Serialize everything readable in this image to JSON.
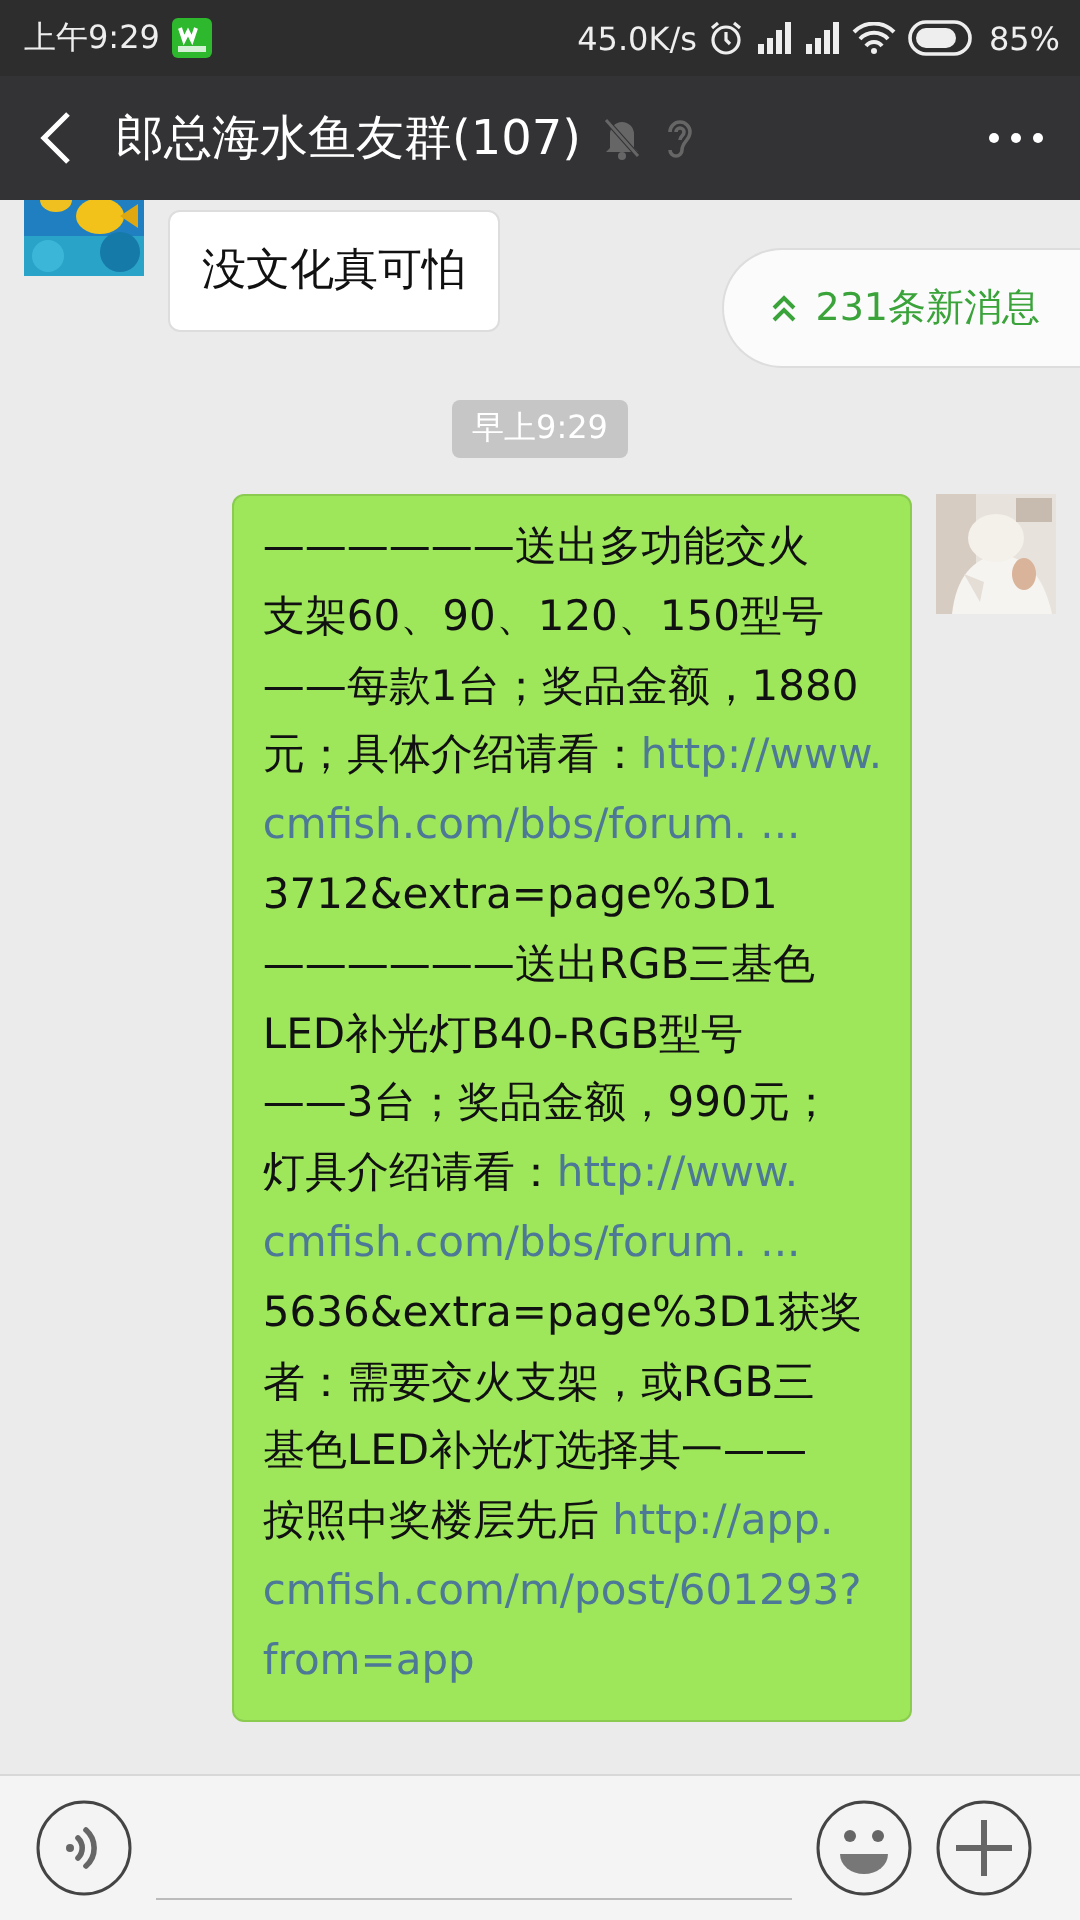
{
  "status_bar": {
    "time": "上午9:29",
    "speed": "45.0K/s",
    "battery": "85%"
  },
  "header": {
    "title": "郎总海水鱼友群(107)"
  },
  "new_messages": {
    "text": "231条新消息"
  },
  "messages": [
    {
      "kind": "bubble",
      "outgoing": false,
      "lines": [
        [
          {
            "kind": "text",
            "text": "没文化真可怕"
          }
        ]
      ]
    },
    {
      "kind": "time",
      "text": "早上9:29"
    },
    {
      "kind": "bubble",
      "outgoing": true,
      "lines": [
        [
          {
            "kind": "text",
            "text": "——————送出多功能交火"
          }
        ],
        [
          {
            "kind": "text",
            "text": "支架60、90、120、150型号"
          }
        ],
        [
          {
            "kind": "text",
            "text": "——每款1台；奖品金额，1880"
          }
        ],
        [
          {
            "kind": "text",
            "text": "元；具体介绍请看："
          },
          {
            "kind": "link",
            "text": "http://www."
          }
        ],
        [
          {
            "kind": "link",
            "text": "cmfish.com/bbs/forum. ..."
          }
        ],
        [
          {
            "kind": "text",
            "text": "3712&extra=page%3D1"
          }
        ],
        [
          {
            "kind": "text",
            "text": "——————送出RGB三基色"
          }
        ],
        [
          {
            "kind": "text",
            "text": "LED补光灯B40-RGB型号"
          }
        ],
        [
          {
            "kind": "text",
            "text": "——3台；奖品金额，990元；"
          }
        ],
        [
          {
            "kind": "text",
            "text": "灯具介绍请看："
          },
          {
            "kind": "link",
            "text": "http://www."
          }
        ],
        [
          {
            "kind": "link",
            "text": "cmfish.com/bbs/forum. ..."
          }
        ],
        [
          {
            "kind": "text",
            "text": "5636&extra=page%3D1获奖"
          }
        ],
        [
          {
            "kind": "text",
            "text": "者：需要交火支架，或RGB三"
          }
        ],
        [
          {
            "kind": "text",
            "text": "基色LED补光灯选择其一——"
          }
        ],
        [
          {
            "kind": "text",
            "text": "按照中奖楼层先后 "
          },
          {
            "kind": "link",
            "text": "http://app."
          }
        ],
        [
          {
            "kind": "link",
            "text": "cmfish.com/m/post/601293?"
          }
        ],
        [
          {
            "kind": "link",
            "text": "from=app"
          }
        ]
      ]
    }
  ]
}
